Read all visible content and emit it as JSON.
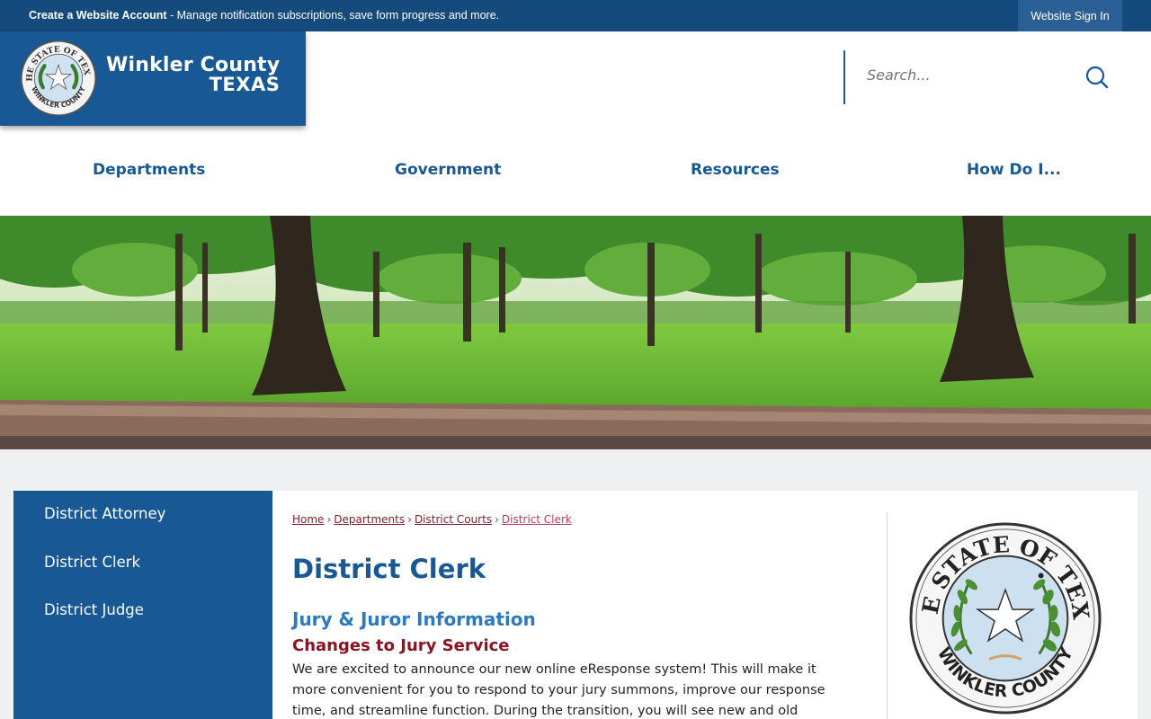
{
  "topbar": {
    "create_account_label": "Create a Website Account",
    "create_account_desc": " - Manage notification subscriptions, save form progress and more.",
    "signin_label": "Website Sign In"
  },
  "logo": {
    "line1": "Winkler County",
    "line2": "TEXAS",
    "seal_top_text": "THE STATE OF TEXAS",
    "seal_bottom_text": "WINKLER COUNTY"
  },
  "search": {
    "placeholder": "Search...",
    "icon": "search-icon"
  },
  "nav": {
    "items": [
      "Departments",
      "Government",
      "Resources",
      "How Do I..."
    ]
  },
  "sidebar": {
    "items": [
      "District Attorney",
      "District Clerk",
      "District Judge"
    ]
  },
  "breadcrumb": {
    "items": [
      "Home",
      "Departments",
      "District Courts",
      "District Clerk"
    ],
    "separator": "›"
  },
  "content": {
    "page_title": "District Clerk",
    "section_title": "Jury & Juror Information",
    "sub_title": "Changes to Jury Service",
    "paragraph": "We are excited to announce our new online eResponse system! This will make it more convenient for you to respond to your jury summons, improve our response time, and streamline function. During the transition, you will see new and old"
  },
  "seal": {
    "top_text": "THE STATE OF TEXAS",
    "bottom_text": "WINKLER COUNTY"
  },
  "colors": {
    "brand_blue": "#175895",
    "topbar_blue": "#144a7c",
    "link_red": "#8a1c2b",
    "subtitle_red": "#8a1424",
    "section_blue": "#2a7ac0"
  }
}
